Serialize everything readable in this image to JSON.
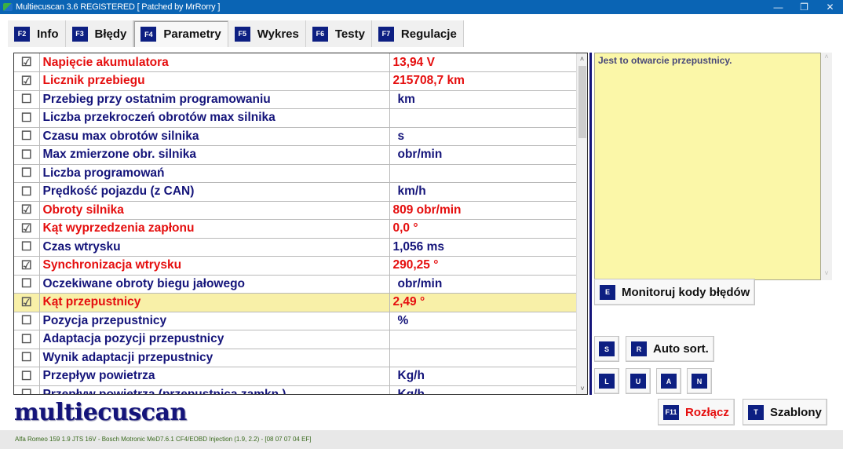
{
  "window": {
    "title": "Multiecuscan 3.6 REGISTERED    [ Patched by MrRorry ]",
    "controls": {
      "minimize": "—",
      "maximize": "❐",
      "close": "✕"
    }
  },
  "tabs": [
    {
      "key": "F2",
      "label": "Info",
      "active": false
    },
    {
      "key": "F3",
      "label": "Błędy",
      "active": false
    },
    {
      "key": "F4",
      "label": "Parametry",
      "active": true
    },
    {
      "key": "F5",
      "label": "Wykres",
      "active": false
    },
    {
      "key": "F6",
      "label": "Testy",
      "active": false
    },
    {
      "key": "F7",
      "label": "Regulacje",
      "active": false
    }
  ],
  "parameters": [
    {
      "checked": true,
      "checkbox": "☑",
      "name": "Napięcie akumulatora",
      "value": "13,94 V"
    },
    {
      "checked": true,
      "checkbox": "☑",
      "name": "Licznik przebiegu",
      "value": "215708,7 km"
    },
    {
      "checked": false,
      "checkbox": "☐",
      "name": "Przebieg przy ostatnim programowaniu",
      "value": "km"
    },
    {
      "checked": false,
      "checkbox": "☐",
      "name": "Liczba przekroczeń obrotów max silnika",
      "value": ""
    },
    {
      "checked": false,
      "checkbox": "☐",
      "name": "Czasu max obrotów silnika",
      "value": "s"
    },
    {
      "checked": false,
      "checkbox": "☐",
      "name": "Max zmierzone obr. silnika",
      "value": "obr/min"
    },
    {
      "checked": false,
      "checkbox": "☐",
      "name": "Liczba programowań",
      "value": ""
    },
    {
      "checked": false,
      "checkbox": "☐",
      "name": "Prędkość pojazdu (z CAN)",
      "value": "km/h"
    },
    {
      "checked": true,
      "checkbox": "☑",
      "name": "Obroty silnika",
      "value": "809 obr/min"
    },
    {
      "checked": true,
      "checkbox": "☑",
      "name": "Kąt wyprzedzenia zapłonu",
      "value": "0,0 °"
    },
    {
      "checked": false,
      "checkbox": "☐",
      "name": "Czas wtrysku",
      "value": "1,056 ms",
      "numeric": true
    },
    {
      "checked": true,
      "checkbox": "☑",
      "name": "Synchronizacja wtrysku",
      "value": "290,25 °"
    },
    {
      "checked": false,
      "checkbox": "☐",
      "name": "Oczekiwane obroty biegu jałowego",
      "value": "obr/min"
    },
    {
      "checked": true,
      "checkbox": "☑",
      "name": "Kąt przepustnicy",
      "value": "2,49 °",
      "selected": true
    },
    {
      "checked": false,
      "checkbox": "☐",
      "name": "Pozycja przepustnicy",
      "value": "%"
    },
    {
      "checked": false,
      "checkbox": "☐",
      "name": "Adaptacja pozycji przepustnicy",
      "value": ""
    },
    {
      "checked": false,
      "checkbox": "☐",
      "name": "Wynik adaptacji przepustnicy",
      "value": ""
    },
    {
      "checked": false,
      "checkbox": "☐",
      "name": "Przepływ powietrza",
      "value": "Kg/h"
    },
    {
      "checked": false,
      "checkbox": "☐",
      "name": "Przepływ powietrza (przepustnica zamkn.)",
      "value": "Kg/h"
    }
  ],
  "scrollbar": {
    "up": "˄",
    "down": "˅"
  },
  "description": "Jest to otwarcie przepustnicy.",
  "buttons": {
    "monitor": {
      "key": "E",
      "label": "Monitoruj kody błędów"
    },
    "s": {
      "key": "S"
    },
    "auto_sort": {
      "key": "R",
      "label": "Auto sort."
    },
    "l": {
      "key": "L"
    },
    "u": {
      "key": "U"
    },
    "a": {
      "key": "A"
    },
    "n": {
      "key": "N"
    },
    "disconnect": {
      "key": "F11",
      "label": "Rozłącz"
    },
    "templates": {
      "key": "T",
      "label": "Szablony"
    }
  },
  "logo": "multiecuscan",
  "status": "Alfa Romeo 159 1.9 JTS 16V - Bosch Motronic MeD7.6.1 CF4/EOBD Injection (1.9, 2.2) - [08 07 07 04 EF]",
  "colors": {
    "active_param": "#e50e0e",
    "inactive_param": "#14147a",
    "key_badge": "#0d1f82",
    "selected_row": "#f8f0a8",
    "description_bg": "#fbf7a8"
  }
}
